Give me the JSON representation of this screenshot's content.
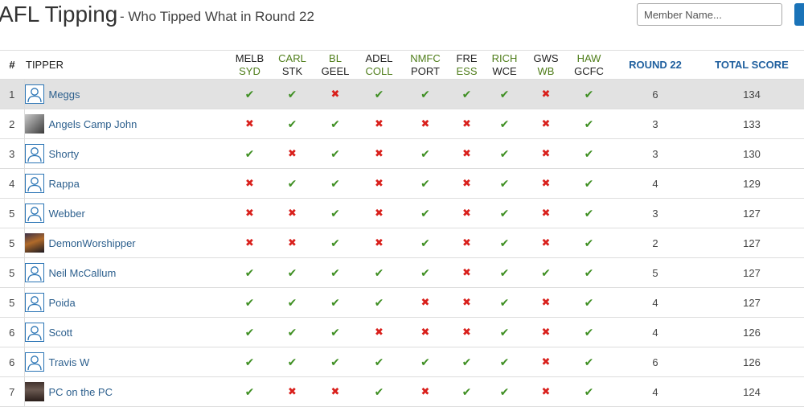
{
  "header": {
    "title": "AFL Tipping",
    "subtitle": "- Who Tipped What in Round 22"
  },
  "search": {
    "placeholder": "Member Name..."
  },
  "columns": {
    "index": "#",
    "tipper": "TIPPER",
    "round": "ROUND 22",
    "total": "TOTAL SCORE"
  },
  "matches": [
    {
      "home": "MELB",
      "away": "SYD",
      "winner": "away"
    },
    {
      "home": "CARL",
      "away": "STK",
      "winner": "home"
    },
    {
      "home": "BL",
      "away": "GEEL",
      "winner": "home"
    },
    {
      "home": "ADEL",
      "away": "COLL",
      "winner": "away"
    },
    {
      "home": "NMFC",
      "away": "PORT",
      "winner": "home"
    },
    {
      "home": "FRE",
      "away": "ESS",
      "winner": "away"
    },
    {
      "home": "RICH",
      "away": "WCE",
      "winner": "home"
    },
    {
      "home": "GWS",
      "away": "WB",
      "winner": "away"
    },
    {
      "home": "HAW",
      "away": "GCFC",
      "winner": "home"
    }
  ],
  "icons": {
    "correct": "check-icon",
    "incorrect": "cross-icon"
  },
  "glyphs": {
    "correct": "✔",
    "incorrect": "✖"
  },
  "colors": {
    "accent": "#2c5f8d",
    "correct": "#3f8f23",
    "incorrect": "#d9201c",
    "winner_team": "#4f7d1a",
    "highlight_row": "#e2e2e2"
  },
  "rows": [
    {
      "rank": "1",
      "name": "Meggs",
      "avatar": "default",
      "tips": [
        1,
        1,
        0,
        1,
        1,
        1,
        1,
        0,
        1
      ],
      "round": "6",
      "total": "134"
    },
    {
      "rank": "2",
      "name": "Angels Camp John",
      "avatar": "photo-a",
      "tips": [
        0,
        1,
        1,
        0,
        0,
        0,
        1,
        0,
        1
      ],
      "round": "3",
      "total": "133"
    },
    {
      "rank": "3",
      "name": "Shorty",
      "avatar": "default",
      "tips": [
        1,
        0,
        1,
        0,
        1,
        0,
        1,
        0,
        1
      ],
      "round": "3",
      "total": "130"
    },
    {
      "rank": "4",
      "name": "Rappa",
      "avatar": "default",
      "tips": [
        0,
        1,
        1,
        0,
        1,
        0,
        1,
        0,
        1
      ],
      "round": "4",
      "total": "129"
    },
    {
      "rank": "5",
      "name": "Webber",
      "avatar": "default",
      "tips": [
        0,
        0,
        1,
        0,
        1,
        0,
        1,
        0,
        1
      ],
      "round": "3",
      "total": "127"
    },
    {
      "rank": "5",
      "name": "DemonWorshipper",
      "avatar": "photo-b",
      "tips": [
        0,
        0,
        1,
        0,
        1,
        0,
        1,
        0,
        1
      ],
      "round": "2",
      "total": "127"
    },
    {
      "rank": "5",
      "name": "Neil McCallum",
      "avatar": "default",
      "tips": [
        1,
        1,
        1,
        1,
        1,
        0,
        1,
        1,
        1
      ],
      "round": "5",
      "total": "127"
    },
    {
      "rank": "5",
      "name": "Poida",
      "avatar": "default",
      "tips": [
        1,
        1,
        1,
        1,
        0,
        0,
        1,
        0,
        1
      ],
      "round": "4",
      "total": "127"
    },
    {
      "rank": "6",
      "name": "Scott",
      "avatar": "default",
      "tips": [
        1,
        1,
        1,
        0,
        0,
        0,
        1,
        0,
        1
      ],
      "round": "4",
      "total": "126"
    },
    {
      "rank": "6",
      "name": "Travis W",
      "avatar": "default",
      "tips": [
        1,
        1,
        1,
        1,
        1,
        1,
        1,
        0,
        1
      ],
      "round": "6",
      "total": "126"
    },
    {
      "rank": "7",
      "name": "PC on the PC",
      "avatar": "photo-c",
      "tips": [
        1,
        0,
        0,
        1,
        0,
        1,
        1,
        0,
        1
      ],
      "round": "4",
      "total": "124"
    }
  ]
}
